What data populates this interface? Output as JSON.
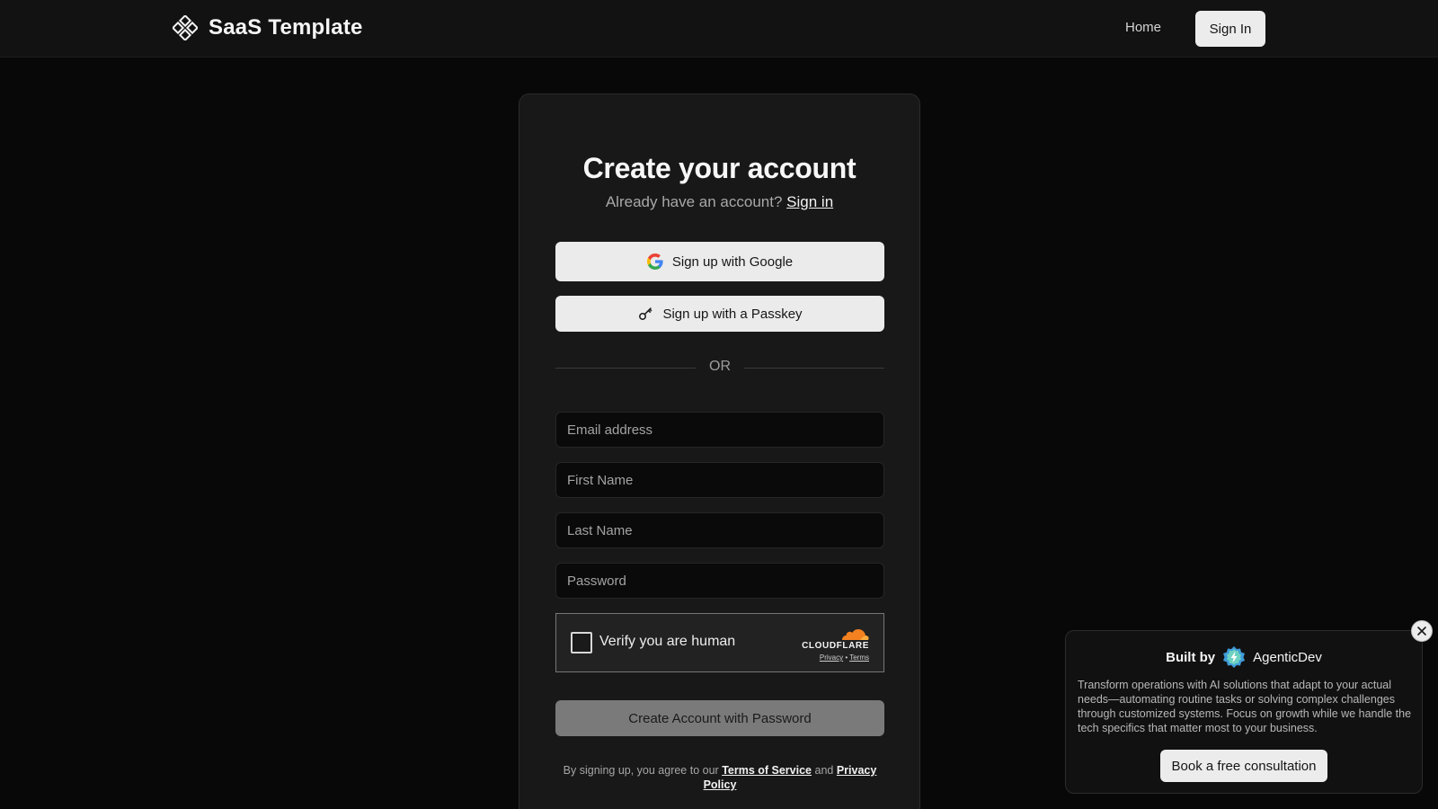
{
  "header": {
    "brand_name": "SaaS Template",
    "brand_icon": "diamond-cluster-icon",
    "nav_home": "Home",
    "nav_signin": "Sign In"
  },
  "form": {
    "title": "Create your account",
    "subtitle_prefix": "Already have an account?",
    "subtitle_link": "Sign in",
    "google_button": "Sign up with Google",
    "passkey_button": "Sign up with a Passkey",
    "divider": "OR",
    "email_placeholder": "Email address",
    "first_name_placeholder": "First Name",
    "last_name_placeholder": "Last Name",
    "password_placeholder": "Password",
    "captcha": {
      "label": "Verify you are human",
      "provider": "CLOUDFLARE",
      "privacy_link": "Privacy",
      "terms_link": "Terms",
      "separator": "•"
    },
    "submit_button": "Create Account with Password",
    "legal": {
      "prefix": "By signing up, you agree to our",
      "terms_link": "Terms of Service",
      "joiner": "and",
      "privacy_link": "Privacy Policy"
    }
  },
  "promo": {
    "built_by": "Built by",
    "company": "AgenticDev",
    "description": "Transform operations with AI solutions that adapt to your actual needs—automating routine tasks or solving complex challenges through customized systems. Focus on growth while we handle the tech specifics that matter most to your business.",
    "cta": "Book a free consultation"
  },
  "colors": {
    "background": "#080808",
    "card": "#181818",
    "accent_button": "#ebebeb",
    "disabled_button": "#7a7a7a",
    "cloudflare_orange": "#f48120"
  }
}
